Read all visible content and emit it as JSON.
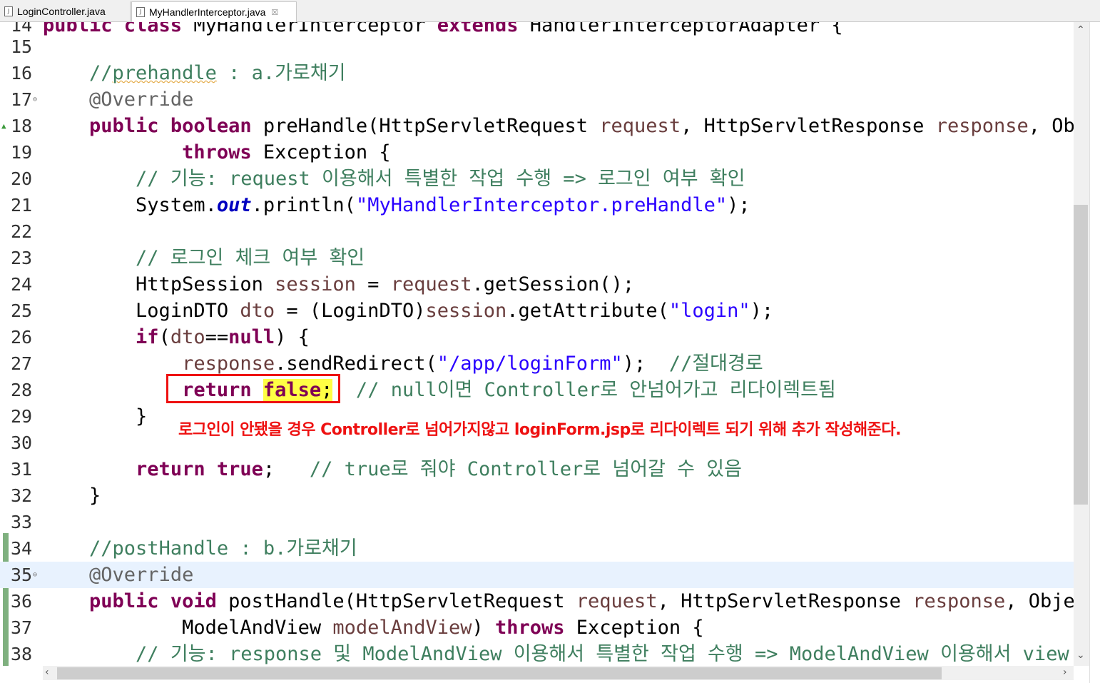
{
  "tabs": [
    {
      "label": "LoginController.java",
      "active": false
    },
    {
      "label": "MyHandlerInterceptor.java",
      "active": true,
      "close": "☒"
    }
  ],
  "editor": {
    "lines": {
      "l14": {
        "num": "14",
        "t1": "public class ",
        "t2": "MyHandlerInterceptor ",
        "t3": "extends ",
        "t4": "HandlerInterceptorAdapter {"
      },
      "l15": {
        "num": "15"
      },
      "l16": {
        "num": "16",
        "c1": "//",
        "c2": "prehandle",
        "c3": " : a.가로채기"
      },
      "l17": {
        "num": "17",
        "a": "@Override"
      },
      "l18": {
        "num": "18",
        "k1": "public ",
        "k2": "boolean ",
        "t1": "preHandle(HttpServletRequest ",
        "v1": "request",
        "t2": ", HttpServletResponse ",
        "v2": "response",
        "t3": ", Obje"
      },
      "l19": {
        "num": "19",
        "k1": "throws",
        "t1": " Exception {"
      },
      "l20": {
        "num": "20",
        "c": "// 기능: request 이용해서 특별한 작업 수행 => 로그인 여부 확인"
      },
      "l21": {
        "num": "21",
        "t1": "System.",
        "f": "out",
        "t2": ".println(",
        "s": "\"MyHandlerInterceptor.preHandle\"",
        "t3": ");"
      },
      "l22": {
        "num": "22"
      },
      "l23": {
        "num": "23",
        "c": "// 로그인 체크 여부 확인"
      },
      "l24": {
        "num": "24",
        "t1": "HttpSession ",
        "v1": "session",
        "t2": " = ",
        "v2": "request",
        "t3": ".getSession();"
      },
      "l25": {
        "num": "25",
        "t1": "LoginDTO ",
        "v1": "dto",
        "t2": " = (LoginDTO)",
        "v2": "session",
        "t3": ".getAttribute(",
        "s": "\"login\"",
        "t4": ");"
      },
      "l26": {
        "num": "26",
        "k1": "if",
        "t1": "(",
        "v1": "dto",
        "t2": "==",
        "k2": "null",
        "t3": ") {"
      },
      "l27": {
        "num": "27",
        "v1": "response",
        "t1": ".sendRedirect(",
        "s": "\"/app/loginForm\"",
        "t2": ");  ",
        "c": "//절대경로"
      },
      "l28": {
        "num": "28",
        "k1": "return ",
        "k2": "false",
        "t1": ";",
        "c": "  // null이면 Controller로 안넘어가고 리다이렉트됨"
      },
      "l29": {
        "num": "29",
        "t1": "}"
      },
      "l30": {
        "num": "30"
      },
      "l31": {
        "num": "31",
        "k1": "return ",
        "k2": "true",
        "t1": ";   ",
        "c": "// true로 줘야 Controller로 넘어갈 수 있음"
      },
      "l32": {
        "num": "32",
        "t1": "}"
      },
      "l33": {
        "num": "33"
      },
      "l34": {
        "num": "34",
        "c": "//postHandle : b.가로채기"
      },
      "l35": {
        "num": "35",
        "a": "@Override"
      },
      "l36": {
        "num": "36",
        "k1": "public ",
        "k2": "void ",
        "t1": "postHandle(HttpServletRequest ",
        "v1": "request",
        "t2": ", HttpServletResponse ",
        "v2": "response",
        "t3": ", Object"
      },
      "l37": {
        "num": "37",
        "t1": "ModelAndView ",
        "v1": "modelAndView",
        "t2": ") ",
        "k1": "throws",
        "t3": " Exception {"
      },
      "l38": {
        "num": "38",
        "c": "// 기능: response 및 ModelAndView 이용해서 특별한 작업 수행 => ModelAndView 이용해서 view 정보"
      }
    }
  },
  "annotation_note": "로그인이 안됐을 경우 Controller로 넘어가지않고 loginForm.jsp로 리다이렉트 되기 위해 추가 작성해준다.",
  "colors": {
    "keyword": "#7f0055",
    "comment": "#3f7f5f",
    "string": "#2a00ff",
    "highlight_box": "#ee1111"
  }
}
